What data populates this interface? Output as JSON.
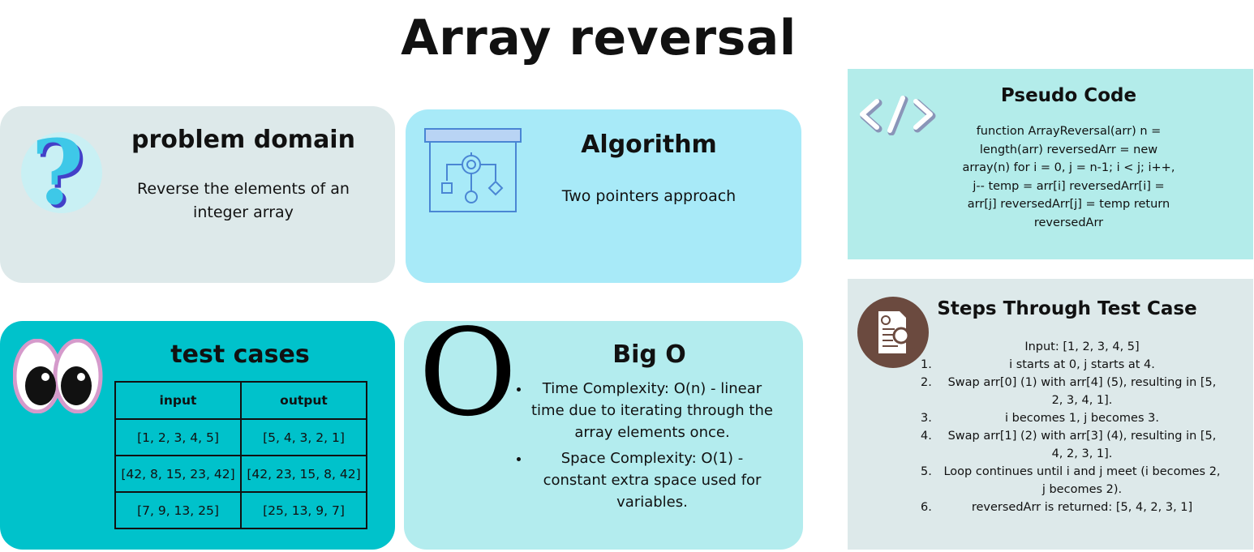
{
  "title": "Array reversal",
  "problem": {
    "heading": "problem domain",
    "text": "Reverse the elements of an integer array"
  },
  "algorithm": {
    "heading": "Algorithm",
    "text": "Two pointers approach"
  },
  "tests": {
    "heading": "test cases",
    "columns": [
      "input",
      "output"
    ],
    "rows": [
      [
        "[1, 2, 3, 4, 5]",
        "[5, 4, 3, 2, 1]"
      ],
      [
        "[42, 8, 15, 23, 42]",
        "[42, 23, 15, 8, 42]"
      ],
      [
        "[7, 9, 13, 25]",
        "[25, 13, 9, 7]"
      ]
    ]
  },
  "bigo": {
    "glyph": "O",
    "heading": "Big O",
    "items": [
      "Time Complexity: O(n) - linear time due to iterating through the array elements once.",
      "Space Complexity: O(1) - constant extra space used for variables."
    ]
  },
  "pseudo": {
    "icon": "code-icon",
    "heading": "Pseudo Code",
    "text": "function ArrayReversal(arr) n = length(arr) reversedArr = new array(n) for i = 0, j = n-1; i < j; i++, j-- temp = arr[i] reversedArr[i] = arr[j] reversedArr[j] = temp return reversedArr"
  },
  "steps": {
    "icon": "document-search-icon",
    "heading": "Steps Through Test Case",
    "input": "Input: [1, 2, 3, 4, 5]",
    "items": [
      {
        "num": "1.",
        "text": "i starts at 0, j starts at 4."
      },
      {
        "num": "2.",
        "text": "Swap arr[0] (1) with arr[4] (5), resulting in [5, 2, 3, 4, 1]."
      },
      {
        "num": "3.",
        "text": "i becomes 1, j becomes 3."
      },
      {
        "num": "4.",
        "text": "Swap arr[1] (2) with arr[3] (4), resulting in [5, 4, 2, 3, 1]."
      },
      {
        "num": "5.",
        "text": "Loop continues until i and j meet (i becomes 2, j becomes 2)."
      },
      {
        "num": "6.",
        "text": "reversedArr is returned: [5, 4, 2, 3, 1]"
      }
    ]
  },
  "colors": {
    "problem_card": "#dde9ea",
    "algorithm_card": "#a8eaf8",
    "tests_card": "#00c2cb",
    "bigo_card": "#b3ecee",
    "pseudo_card": "#b3ecea",
    "steps_card": "#dde9ea",
    "question_mark": "#3ec8e8",
    "eye_ring": "#d59acb",
    "steps_icon_bg": "#6b4a3f"
  }
}
